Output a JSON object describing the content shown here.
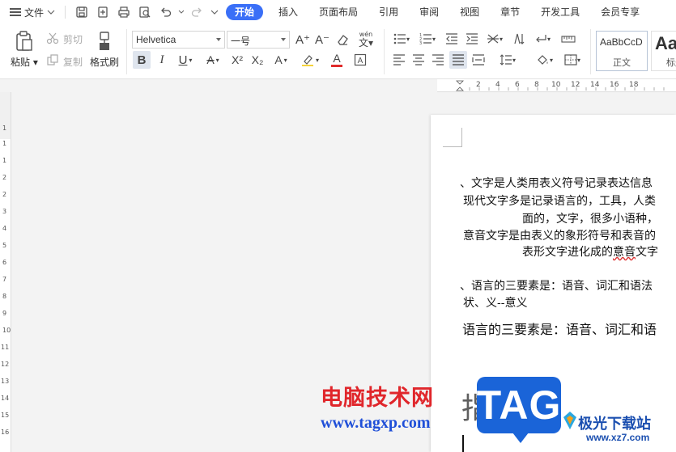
{
  "menubar": {
    "file_label": "文件",
    "tabs": [
      "开始",
      "插入",
      "页面布局",
      "引用",
      "审阅",
      "视图",
      "章节",
      "开发工具",
      "会员专享"
    ]
  },
  "ribbon": {
    "paste_label": "粘贴",
    "cut_label": "剪切",
    "copy_label": "复制",
    "format_painter_label": "格式刷",
    "font_name": "Helvetica",
    "font_size": "一号",
    "wen_label": "wén",
    "styles": [
      {
        "preview": "AaBbCcD",
        "name": "正文"
      },
      {
        "preview": "Aa",
        "name": "标题"
      }
    ]
  },
  "hruler": {
    "ticks": [
      "2",
      "4",
      "6",
      "8",
      "10",
      "12",
      "14",
      "16",
      "18"
    ]
  },
  "vruler": {
    "ticks": [
      "1",
      "1",
      "2",
      "1",
      "2",
      "3",
      "4",
      "5",
      "6",
      "7",
      "8",
      "9",
      "10",
      "11",
      "12",
      "13",
      "14",
      "15",
      "16",
      "17",
      "18"
    ]
  },
  "document": {
    "p1_line1": "、文字是人类用表义符号记录表达信息",
    "p1_line2": "现代文字多是记录语言的，工具，人类",
    "p1_line3": "面的，文字，很多小语种，",
    "p1_line4": "意音文字是由表义的象形符号和表音的",
    "p1_line5_pre": "表形文字进化成的",
    "p1_line5_ul": "意音",
    "p1_line5_post": "文字",
    "p2_line1": "、语言的三要素是：语音、词汇和语法",
    "p2_line2": "状、义--意义",
    "p3_line1": "语言的三要素是：语音、词汇和语"
  },
  "watermark": {
    "site_cn": "电脑技术网",
    "site_url": "www.tagxp.com",
    "ghost_text": "指定行",
    "tag_logo": "TAG",
    "xz_cn": "极光下载站",
    "xz_url": "www.xz7.com"
  },
  "colors": {
    "accent": "#3a6ff7",
    "watermark_red": "#e0262b",
    "watermark_blue": "#1f4fd8"
  }
}
